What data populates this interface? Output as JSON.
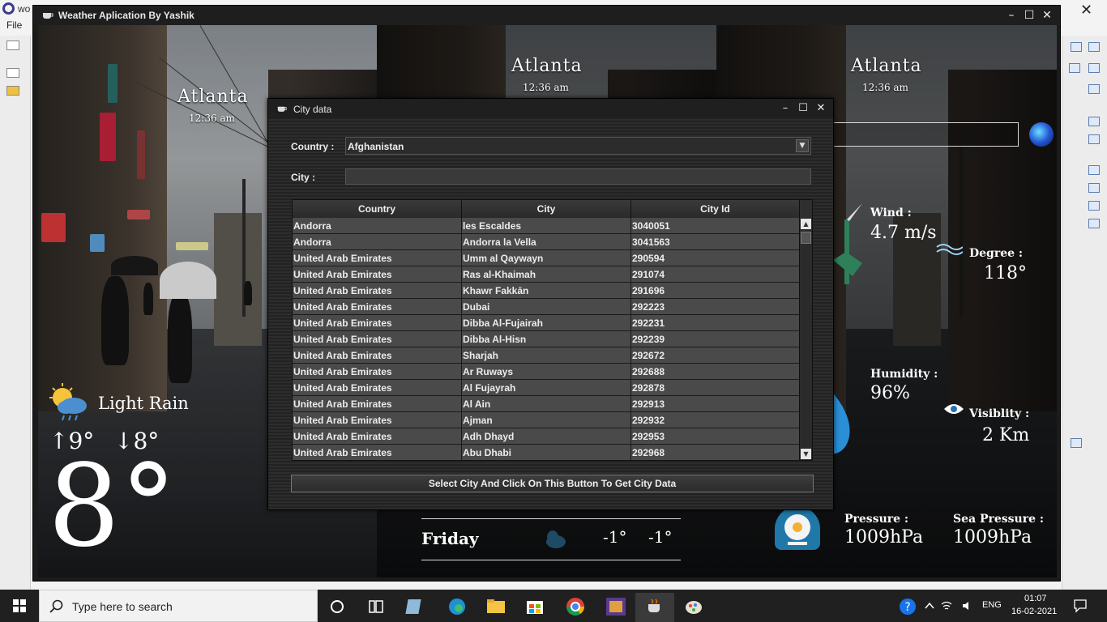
{
  "ide": {
    "title_fragment": "wo",
    "menu_file": "File"
  },
  "weather_window": {
    "title": "Weather Aplication By Yashik",
    "controls": [
      "–",
      "☐",
      "✕"
    ],
    "panel_a": {
      "city": "Atlanta",
      "time": "12:36 am",
      "condition": "Light Rain",
      "high": "↑9°",
      "low": "↓8°",
      "temperature": "8°"
    },
    "panel_b": {
      "city": "Atlanta",
      "time": "12:36 am",
      "forecast": {
        "day": "Friday",
        "high": "-1°",
        "low": "-1°"
      }
    },
    "panel_c": {
      "city": "Atlanta",
      "time": "12:36 am",
      "wind_label": "Wind :",
      "wind_value": "4.7 m/s",
      "degree_label": "Degree :",
      "degree_value": "118°",
      "humidity_label": "Humidity :",
      "humidity_value": "96%",
      "visibility_label": "Visiblity :",
      "visibility_value": "2 Km",
      "pressure_label": "Pressure :",
      "pressure_value": "1009hPa",
      "sea_pressure_label": "Sea Pressure :",
      "sea_pressure_value": "1009hPa"
    }
  },
  "city_dialog": {
    "title": "City data",
    "controls": [
      "–",
      "☐",
      "✕"
    ],
    "country_label": "Country :",
    "country_value": "Afghanistan",
    "city_label": "City :",
    "city_value": "",
    "columns": [
      "Country",
      "City",
      "City Id"
    ],
    "rows": [
      [
        "Andorra",
        "les Escaldes",
        "3040051"
      ],
      [
        "Andorra",
        "Andorra la Vella",
        "3041563"
      ],
      [
        "United Arab Emirates",
        "Umm al Qaywayn",
        "290594"
      ],
      [
        "United Arab Emirates",
        "Ras al-Khaimah",
        "291074"
      ],
      [
        "United Arab Emirates",
        "Khawr Fakkān",
        "291696"
      ],
      [
        "United Arab Emirates",
        "Dubai",
        "292223"
      ],
      [
        "United Arab Emirates",
        "Dibba Al-Fujairah",
        "292231"
      ],
      [
        "United Arab Emirates",
        "Dibba Al-Hisn",
        "292239"
      ],
      [
        "United Arab Emirates",
        "Sharjah",
        "292672"
      ],
      [
        "United Arab Emirates",
        "Ar Ruways",
        "292688"
      ],
      [
        "United Arab Emirates",
        "Al Fujayrah",
        "292878"
      ],
      [
        "United Arab Emirates",
        "Al Ain",
        "292913"
      ],
      [
        "United Arab Emirates",
        "Ajman",
        "292932"
      ],
      [
        "United Arab Emirates",
        "Adh Dhayd",
        "292953"
      ],
      [
        "United Arab Emirates",
        "Abu Dhabi",
        "292968"
      ]
    ],
    "button_label": "Select City And Click On This Button To Get City Data"
  },
  "taskbar": {
    "search_placeholder": "Type here to search",
    "language": "ENG",
    "time": "01:07",
    "date": "16-02-2021"
  }
}
